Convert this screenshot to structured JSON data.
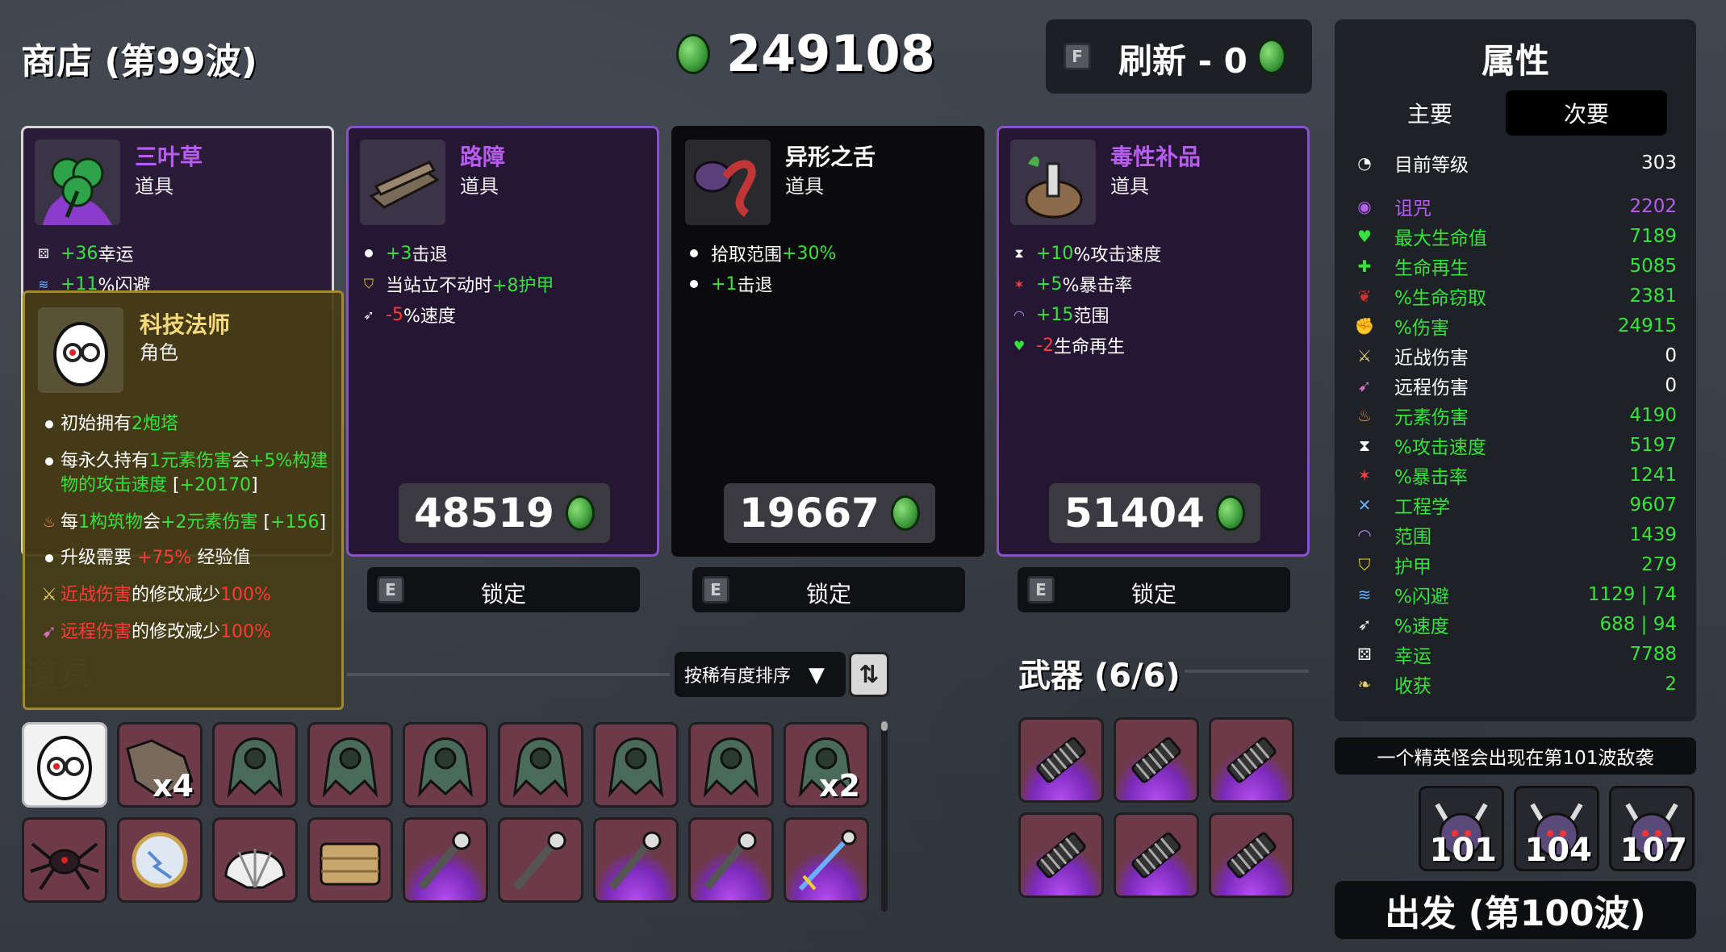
{
  "header": {
    "shop_title": "商店 (第99波)",
    "gold": "249108",
    "refresh_key": "F",
    "refresh_label": "刷新 - 0"
  },
  "shop_items": [
    {
      "name": "三叶草",
      "type": "道具",
      "icon": "clover-icon",
      "stats": [
        {
          "icon": "dice-icon",
          "value": "+36",
          "value_color": "green",
          "text": " 幸运"
        },
        {
          "icon": "dodge-icon",
          "value": "+11",
          "value_color": "green",
          "text": " %闪避"
        }
      ]
    },
    {
      "name": "路障",
      "type": "道具",
      "icon": "barricade-icon",
      "price": "48519",
      "lock_key": "E",
      "lock_label": "锁定",
      "stats": [
        {
          "icon": "dot",
          "value": "+3",
          "value_color": "green",
          "text": "击退"
        },
        {
          "icon": "armor-icon",
          "pre": "当站立不动时",
          "value": "+8护甲",
          "value_color": "green",
          "text": ""
        },
        {
          "icon": "speed-icon",
          "value": "-5",
          "value_color": "red",
          "text": " %速度"
        }
      ]
    },
    {
      "name": "异形之舌",
      "type": "道具",
      "icon": "alien-tongue-icon",
      "price": "19667",
      "lock_key": "E",
      "lock_label": "锁定",
      "stats": [
        {
          "icon": "dot",
          "pre": "拾取范围",
          "value": "+30%",
          "value_color": "green",
          "text": ""
        },
        {
          "icon": "dot",
          "value": "+1",
          "value_color": "green",
          "text": "击退"
        }
      ]
    },
    {
      "name": "毒性补品",
      "type": "道具",
      "icon": "toxic-tonic-icon",
      "price": "51404",
      "lock_key": "E",
      "lock_label": "锁定",
      "stats": [
        {
          "icon": "hourglass-icon",
          "value": "+10",
          "value_color": "green",
          "text": " %攻击速度"
        },
        {
          "icon": "crit-icon",
          "value": "+5",
          "value_color": "green",
          "text": " %暴击率"
        },
        {
          "icon": "range-icon",
          "value": "+15",
          "value_color": "green",
          "text": " 范围"
        },
        {
          "icon": "regen-icon",
          "value": "-2",
          "value_color": "red",
          "text": " 生命再生"
        }
      ]
    }
  ],
  "tooltip": {
    "name": "科技法师",
    "type": "角色",
    "lines": [
      {
        "icon": "dot",
        "parts": [
          {
            "t": "初始拥有",
            "c": "white"
          },
          {
            "t": "2炮塔",
            "c": "green"
          }
        ]
      },
      {
        "icon": "dot",
        "parts": [
          {
            "t": "每永久持有",
            "c": "white"
          },
          {
            "t": "1元素伤害",
            "c": "green"
          },
          {
            "t": "会",
            "c": "white"
          },
          {
            "t": "+5%构建物的攻击速度",
            "c": "green"
          },
          {
            "t": " [",
            "c": "white"
          },
          {
            "t": "+20170",
            "c": "green"
          },
          {
            "t": "]",
            "c": "white"
          }
        ]
      },
      {
        "icon": "elemental-icon",
        "parts": [
          {
            "t": "每",
            "c": "white"
          },
          {
            "t": "1构筑物",
            "c": "green"
          },
          {
            "t": "会",
            "c": "white"
          },
          {
            "t": "+2元素伤害",
            "c": "green"
          },
          {
            "t": " [",
            "c": "white"
          },
          {
            "t": "+156",
            "c": "green"
          },
          {
            "t": "]",
            "c": "white"
          }
        ]
      },
      {
        "icon": "dot",
        "parts": [
          {
            "t": "升级需要 ",
            "c": "white"
          },
          {
            "t": "+75%",
            "c": "red"
          },
          {
            "t": " 经验值",
            "c": "white"
          }
        ]
      },
      {
        "icon": "melee-icon",
        "parts": [
          {
            "t": "近战伤害",
            "c": "red"
          },
          {
            "t": "的修改减少",
            "c": "white"
          },
          {
            "t": "100%",
            "c": "red"
          }
        ]
      },
      {
        "icon": "ranged-icon",
        "parts": [
          {
            "t": "远程伤害",
            "c": "red"
          },
          {
            "t": "的修改减少",
            "c": "white"
          },
          {
            "t": "100%",
            "c": "red"
          }
        ]
      }
    ]
  },
  "inventory": {
    "title": "道具",
    "sort_label": "按稀有度排序",
    "row1": [
      {
        "icon": "engineer-egg-icon",
        "qty": ""
      },
      {
        "icon": "wolf-head-icon",
        "qty": "x4"
      },
      {
        "icon": "turret-icon",
        "qty": ""
      },
      {
        "icon": "turret-icon",
        "qty": ""
      },
      {
        "icon": "turret-icon",
        "qty": ""
      },
      {
        "icon": "turret-icon",
        "qty": ""
      },
      {
        "icon": "turret-icon",
        "qty": ""
      },
      {
        "icon": "turret-icon",
        "qty": ""
      },
      {
        "icon": "turret-icon",
        "qty": "x2"
      }
    ],
    "row2": [
      {
        "icon": "spider-icon",
        "qty": ""
      },
      {
        "icon": "electric-orb-icon",
        "qty": ""
      },
      {
        "icon": "seashell-icon",
        "qty": ""
      },
      {
        "icon": "hay-bale-icon",
        "qty": ""
      },
      {
        "icon": "wrench-tool-icon",
        "qty": ""
      },
      {
        "icon": "wrench-tool-icon",
        "qty": ""
      },
      {
        "icon": "wrench-tool-icon",
        "qty": ""
      },
      {
        "icon": "wrench-tool-icon",
        "qty": ""
      },
      {
        "icon": "laser-wrench-icon",
        "qty": ""
      }
    ]
  },
  "weapons": {
    "title": "武器 (6/6)",
    "items": [
      "spring-gun-icon",
      "spring-gun-icon",
      "spring-gun-icon",
      "spring-gun-icon",
      "spring-gun-icon",
      "spring-gun-icon"
    ]
  },
  "stats_panel": {
    "title": "属性",
    "tab_primary": "主要",
    "tab_secondary": "次要",
    "level_label": "目前等级",
    "level_value": "303",
    "rows": [
      {
        "icon": "curse-icon",
        "label": "诅咒",
        "value": "2202",
        "color": "#b95cf0"
      },
      {
        "icon": "heart-icon",
        "label": "最大生命值",
        "value": "7189",
        "color": "#37e23c"
      },
      {
        "icon": "regen-icon",
        "label": "生命再生",
        "value": "5085",
        "color": "#37e23c"
      },
      {
        "icon": "lifesteal-icon",
        "label": "%生命窃取",
        "value": "2381",
        "color": "#37e23c"
      },
      {
        "icon": "damage-icon",
        "label": "%伤害",
        "value": "24915",
        "color": "#37e23c"
      },
      {
        "icon": "melee-icon",
        "label": "近战伤害",
        "value": "0",
        "color": "#ffffff"
      },
      {
        "icon": "ranged-icon",
        "label": "远程伤害",
        "value": "0",
        "color": "#ffffff"
      },
      {
        "icon": "elemental-icon",
        "label": "元素伤害",
        "value": "4190",
        "color": "#37e23c"
      },
      {
        "icon": "hourglass-icon",
        "label": "%攻击速度",
        "value": "5197",
        "color": "#37e23c"
      },
      {
        "icon": "crit-icon",
        "label": "%暴击率",
        "value": "1241",
        "color": "#37e23c"
      },
      {
        "icon": "engineering-icon",
        "label": "工程学",
        "value": "9607",
        "color": "#37e23c"
      },
      {
        "icon": "range-icon",
        "label": "范围",
        "value": "1439",
        "color": "#37e23c"
      },
      {
        "icon": "armor-icon",
        "label": "护甲",
        "value": "279",
        "color": "#37e23c"
      },
      {
        "icon": "dodge-icon",
        "label": "%闪避",
        "value": "1129 | 74",
        "color": "#37e23c"
      },
      {
        "icon": "speed-icon",
        "label": "%速度",
        "value": "688 | 94",
        "color": "#37e23c"
      },
      {
        "icon": "dice-icon",
        "label": "幸运",
        "value": "7788",
        "color": "#37e23c"
      },
      {
        "icon": "harvest-icon",
        "label": "收获",
        "value": "2",
        "color": "#37e23c"
      }
    ]
  },
  "elite_banner": "一个精英怪会出现在第101波敌袭",
  "elite_waves": [
    "101",
    "104",
    "107"
  ],
  "go_button": "出发 (第100波)",
  "colors": {
    "green": "#37e23c",
    "red": "#ff3a3a",
    "purple": "#b95cf0",
    "gold_text": "#f5d97a"
  }
}
